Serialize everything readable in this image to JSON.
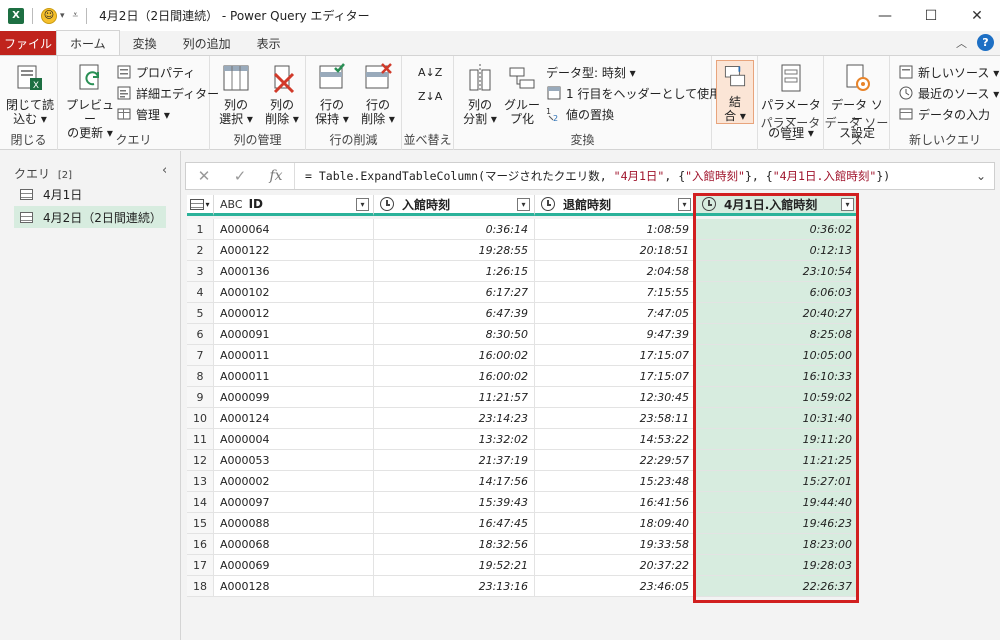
{
  "window": {
    "title": "4月2日（2日間連続） - Power Query エディター",
    "app_logo_letter": "X",
    "minimize": "—",
    "maximize": "☐",
    "close": "✕"
  },
  "tabs": [
    {
      "label": "ファイル"
    },
    {
      "label": "ホーム"
    },
    {
      "label": "変換"
    },
    {
      "label": "列の追加"
    },
    {
      "label": "表示"
    }
  ],
  "ribbon": {
    "close_group": {
      "label": "閉じる",
      "close_load": "閉じて読\n込む ▾"
    },
    "query_group": {
      "label": "クエリ",
      "preview_refresh": "プレビュー\nの更新 ▾",
      "properties": "プロパティ",
      "advanced_editor": "詳細エディター",
      "manage": "管理 ▾"
    },
    "column_manage_group": {
      "label": "列の管理",
      "choose_columns": "列の\n選択 ▾",
      "remove_columns": "列の\n削除 ▾"
    },
    "row_reduce_group": {
      "label": "行の削減",
      "keep_rows": "行の\n保持 ▾",
      "remove_rows": "行の\n削除 ▾"
    },
    "sort_group": {
      "label": "並べ替え",
      "sort_asc": "A↓Z",
      "sort_desc": "Z↓A"
    },
    "transform_group": {
      "label": "変換",
      "split_column": "列の\n分割 ▾",
      "group_by": "グルー\nプ化",
      "data_type": "データ型: 時刻 ▾",
      "use_first_row": "1 行目をヘッダーとして使用 ▾",
      "replace_values": "値の置換"
    },
    "combine_group": {
      "label": "",
      "combine": "結\n合 ▾"
    },
    "parameters_group": {
      "label": "パラメーター",
      "manage_parameters": "パラメーター\nの管理 ▾"
    },
    "datasource_group": {
      "label": "データ ソース",
      "datasource_settings": "データ ソー\nス設定"
    },
    "newquery_group": {
      "label": "新しいクエリ",
      "new_source": "新しいソース ▾",
      "recent_sources": "最近のソース ▾",
      "enter_data": "データの入力"
    }
  },
  "queries_panel": {
    "title": "クエリ",
    "count": "[2]",
    "items": [
      {
        "label": "4月1日"
      },
      {
        "label": "4月2日（2日間連続）"
      }
    ]
  },
  "formula_bar": {
    "prefix": "= Table.ExpandTableColumn(マージされたクエリ数, ",
    "arg1": "\"4月1日\"",
    "mid1": ", {",
    "arg2": "\"入館時刻\"",
    "mid2": "}, {",
    "arg3": "\"4月1日.入館時刻\"",
    "suffix": "})"
  },
  "grid": {
    "columns": [
      {
        "type_label": "ABC",
        "name": "ID"
      },
      {
        "type_label": "time",
        "name": "入館時刻"
      },
      {
        "type_label": "time",
        "name": "退館時刻"
      },
      {
        "type_label": "time",
        "name": "4月1日.入館時刻"
      }
    ],
    "rows": [
      {
        "n": "1",
        "id": "A000064",
        "in": "0:36:14",
        "out": "1:08:59",
        "prev": "0:36:02"
      },
      {
        "n": "2",
        "id": "A000122",
        "in": "19:28:55",
        "out": "20:18:51",
        "prev": "0:12:13"
      },
      {
        "n": "3",
        "id": "A000136",
        "in": "1:26:15",
        "out": "2:04:58",
        "prev": "23:10:54"
      },
      {
        "n": "4",
        "id": "A000102",
        "in": "6:17:27",
        "out": "7:15:55",
        "prev": "6:06:03"
      },
      {
        "n": "5",
        "id": "A000012",
        "in": "6:47:39",
        "out": "7:47:05",
        "prev": "20:40:27"
      },
      {
        "n": "6",
        "id": "A000091",
        "in": "8:30:50",
        "out": "9:47:39",
        "prev": "8:25:08"
      },
      {
        "n": "7",
        "id": "A000011",
        "in": "16:00:02",
        "out": "17:15:07",
        "prev": "10:05:00"
      },
      {
        "n": "8",
        "id": "A000011",
        "in": "16:00:02",
        "out": "17:15:07",
        "prev": "16:10:33"
      },
      {
        "n": "9",
        "id": "A000099",
        "in": "11:21:57",
        "out": "12:30:45",
        "prev": "10:59:02"
      },
      {
        "n": "10",
        "id": "A000124",
        "in": "23:14:23",
        "out": "23:58:11",
        "prev": "10:31:40"
      },
      {
        "n": "11",
        "id": "A000004",
        "in": "13:32:02",
        "out": "14:53:22",
        "prev": "19:11:20"
      },
      {
        "n": "12",
        "id": "A000053",
        "in": "21:37:19",
        "out": "22:29:57",
        "prev": "11:21:25"
      },
      {
        "n": "13",
        "id": "A000002",
        "in": "14:17:56",
        "out": "15:23:48",
        "prev": "15:27:01"
      },
      {
        "n": "14",
        "id": "A000097",
        "in": "15:39:43",
        "out": "16:41:56",
        "prev": "19:44:40"
      },
      {
        "n": "15",
        "id": "A000088",
        "in": "16:47:45",
        "out": "18:09:40",
        "prev": "19:46:23"
      },
      {
        "n": "16",
        "id": "A000068",
        "in": "18:32:56",
        "out": "19:33:58",
        "prev": "18:23:00"
      },
      {
        "n": "17",
        "id": "A000069",
        "in": "19:52:21",
        "out": "20:37:22",
        "prev": "19:28:03"
      },
      {
        "n": "18",
        "id": "A000128",
        "in": "23:13:16",
        "out": "23:46:05",
        "prev": "22:26:37"
      }
    ]
  },
  "colors": {
    "file_tab": "#c0231c",
    "selected_column": "#d7ecdf",
    "highlight_border": "#d11f1f",
    "header_underline": "#2bb29a"
  }
}
